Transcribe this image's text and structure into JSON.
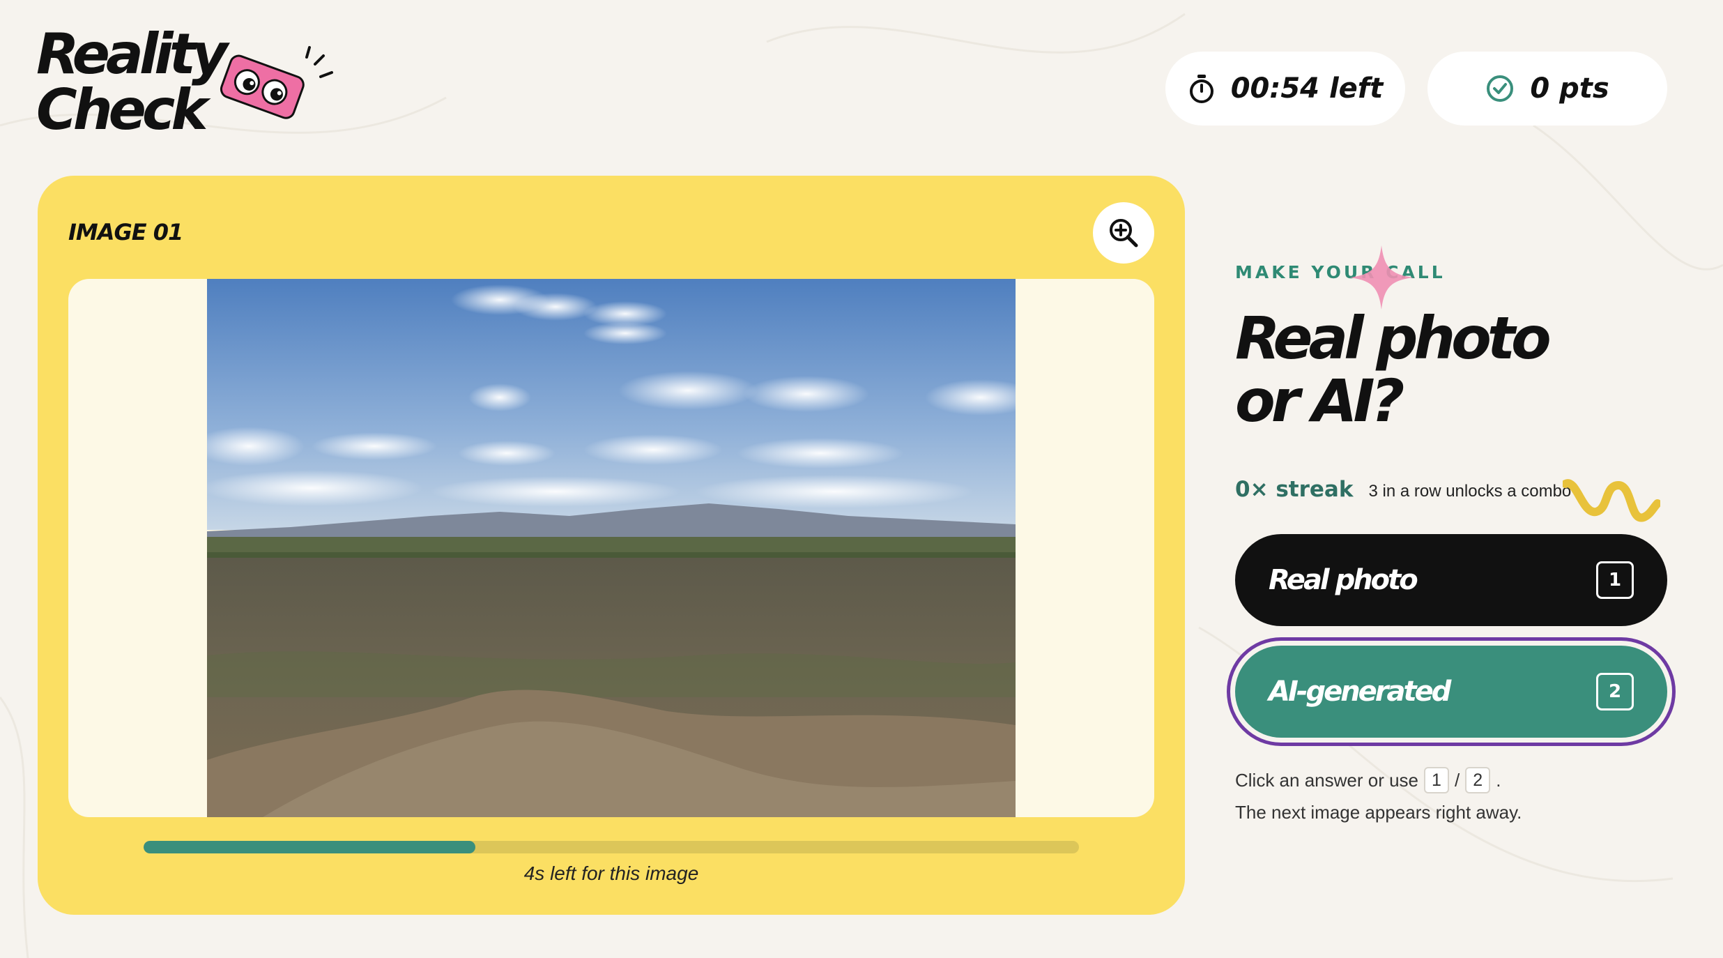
{
  "app": {
    "logo_line1": "Reality",
    "logo_line2": "Check"
  },
  "header": {
    "timer_text": "00:54 left",
    "score_text": "0 pts"
  },
  "card": {
    "label": "IMAGE 01",
    "progress_fraction": 0.355,
    "progress_text": "4s left for this image"
  },
  "panel": {
    "eyebrow": "MAKE YOUR CALL",
    "headline_line1": "Real photo",
    "headline_line2": "or AI?",
    "streak_count": "0× streak",
    "streak_hint": "3 in a row unlocks a combo",
    "answers": [
      {
        "label": "Real photo",
        "key": "1"
      },
      {
        "label": "AI-generated",
        "key": "2"
      }
    ],
    "help_text_before": "Click an answer or use",
    "help_key1": "1",
    "help_separator": "/",
    "help_key2": "2",
    "help_text_after": ".",
    "help_line2": "The next image appears right away."
  },
  "colors": {
    "background": "#f6f3ee",
    "card": "#fbdf63",
    "accent_green": "#3a8f7c",
    "focus_ring": "#6e3aa3",
    "ink": "#111111"
  },
  "icons": {
    "timer": "stopwatch-icon",
    "score": "check-circle-icon",
    "zoom": "zoom-in-icon"
  }
}
